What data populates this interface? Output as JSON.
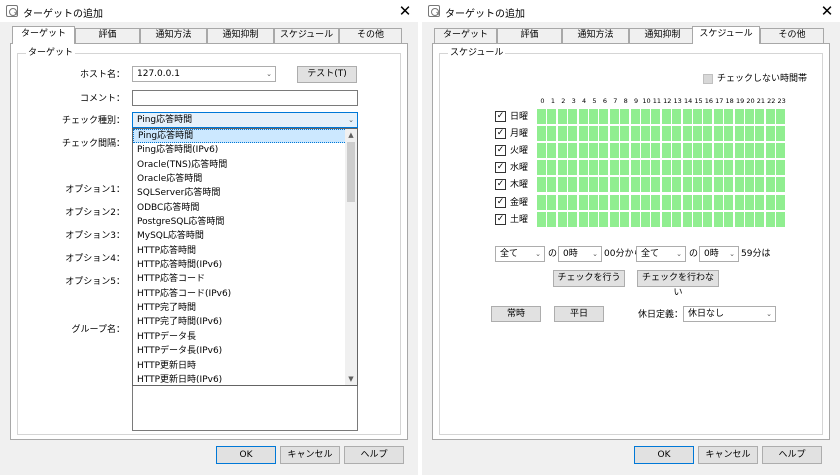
{
  "left": {
    "title": "ターゲットの追加",
    "tabs": [
      "ターゲット",
      "評価",
      "通知方法",
      "通知抑制",
      "スケジュール",
      "その他"
    ],
    "group_label": "ターゲット",
    "host_label": "ホスト名：",
    "host_value": "127.0.0.1",
    "test_button": "テスト(T)",
    "comment_label": "コメント：",
    "check_type_label": "チェック種別：",
    "check_type_value": "Ping応答時間",
    "interval_label": "チェック間隔：",
    "option1_label": "オプション1：",
    "option2_label": "オプション2：",
    "option3_label": "オプション3：",
    "option4_label": "オプション4：",
    "option5_label": "オプション5：",
    "group_name_label": "グループ名：",
    "dropdown_items": [
      "Ping応答時間",
      "Ping応答時間(IPv6)",
      "Oracle(TNS)応答時間",
      "Oracle応答時間",
      "SQLServer応答時間",
      "ODBC応答時間",
      "PostgreSQL応答時間",
      "MySQL応答時間",
      "HTTP応答時間",
      "HTTP応答時間(IPv6)",
      "HTTP応答コード",
      "HTTP応答コード(IPv6)",
      "HTTP完了時間",
      "HTTP完了時間(IPv6)",
      "HTTPデータ長",
      "HTTPデータ長(IPv6)",
      "HTTP更新日時",
      "HTTP更新日時(IPv6)"
    ],
    "ok": "OK",
    "cancel": "キャンセル",
    "help": "ヘルプ"
  },
  "right": {
    "title": "ターゲットの追加",
    "tabs": [
      "ターゲット",
      "評価",
      "通知方法",
      "通知抑制",
      "スケジュール",
      "その他"
    ],
    "group_label": "スケジュール",
    "legend_label": "チェックしない時間帯",
    "hours": [
      "0",
      "1",
      "2",
      "3",
      "4",
      "5",
      "6",
      "7",
      "8",
      "9",
      "10",
      "11",
      "12",
      "13",
      "14",
      "15",
      "16",
      "17",
      "18",
      "19",
      "20",
      "21",
      "22",
      "23"
    ],
    "days": [
      {
        "label": "日曜",
        "checked": true
      },
      {
        "label": "月曜",
        "checked": true
      },
      {
        "label": "火曜",
        "checked": true
      },
      {
        "label": "水曜",
        "checked": true
      },
      {
        "label": "木曜",
        "checked": true
      },
      {
        "label": "金曜",
        "checked": true
      },
      {
        "label": "土曜",
        "checked": true
      }
    ],
    "checkmark": "✓",
    "day_select_1": "全て",
    "no_1": "の",
    "hour_select_1": "0時",
    "from_text": "00分から",
    "day_select_2": "全て",
    "no_2": "の",
    "hour_select_2": "0時",
    "to_text": "59分は",
    "do_check": "チェックを行う",
    "no_check": "チェックを行わない",
    "always": "常時",
    "weekday": "平日",
    "holiday_label": "休日定義：",
    "holiday_value": "休日なし",
    "ok": "OK",
    "cancel": "キャンセル",
    "help": "ヘルプ"
  },
  "colors": {
    "cell_on": "#90ee90",
    "accent": "#0078d7",
    "selection": "#cce8ff"
  }
}
